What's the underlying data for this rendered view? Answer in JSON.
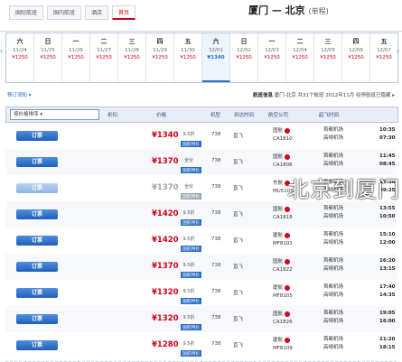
{
  "header": {
    "tabs": [
      "国际航班",
      "国内航班",
      "酒店",
      "首页"
    ],
    "route": "厦门 — 北京",
    "route_sub": "(单程)"
  },
  "date_strip": [
    {
      "dow": "六",
      "date": "11/24",
      "price": "¥1250"
    },
    {
      "dow": "日",
      "date": "11/25",
      "price": "¥1250"
    },
    {
      "dow": "一",
      "date": "11/26",
      "price": "¥1250"
    },
    {
      "dow": "二",
      "date": "11/27",
      "price": "¥1250"
    },
    {
      "dow": "三",
      "date": "11/28",
      "price": "¥1250"
    },
    {
      "dow": "四",
      "date": "11/29",
      "price": "¥1250"
    },
    {
      "dow": "五",
      "date": "11/30",
      "price": "¥1250"
    },
    {
      "dow": "六",
      "date": "12/01",
      "price": "¥1340"
    },
    {
      "dow": "日",
      "date": "12/02",
      "price": "¥1250"
    },
    {
      "dow": "一",
      "date": "12/03",
      "price": "¥1250"
    },
    {
      "dow": "二",
      "date": "12/04",
      "price": "¥1250"
    },
    {
      "dow": "三",
      "date": "12/05",
      "price": "¥1250"
    },
    {
      "dow": "四",
      "date": "12/06",
      "price": "¥1250"
    },
    {
      "dow": "五",
      "date": "12/07",
      "price": "¥1250"
    }
  ],
  "filters": {
    "left": "预订须知 ▾",
    "right_label": "航班信息",
    "right_text": "厦门-北京 共31个航班 2012年11月 经停航班已隐藏 ▸"
  },
  "table_headers": {
    "sort": "按价格排序 ▾",
    "col_price": "价格",
    "col_discount": "折扣",
    "col_type": "机型",
    "col_arrive": "到达时间",
    "col_airline": "航空公司",
    "col_depart": "起飞时间"
  },
  "flights": [
    {
      "book": "订票",
      "price": "¥1340",
      "disc": "9.5折",
      "tag": "国航特价",
      "type": "738",
      "stop": "直飞",
      "airline": "国航",
      "no": "CA1810",
      "arr_apt": "首都机场",
      "dep_apt": "高崎机场",
      "arr": "10:35",
      "dep": "07:30"
    },
    {
      "book": "订票",
      "price": "¥1370",
      "disc": "全价",
      "tag": "国航特价",
      "type": "738",
      "stop": "直飞",
      "airline": "国航",
      "no": "CA1806",
      "arr_apt": "首都机场",
      "dep_apt": "高崎机场",
      "arr": "11:45",
      "dep": "08:45"
    },
    {
      "book": "订票",
      "price": "¥1370",
      "disc": "全价",
      "tag": "国航特价",
      "type": "738",
      "stop": "直飞",
      "airline": "东航",
      "no": "MU5105",
      "arr_apt": "首都机场",
      "dep_apt": "高崎机场",
      "arr": "12:30",
      "dep": "09:25",
      "muted": true
    },
    {
      "book": "订票",
      "price": "¥1420",
      "disc": "9.5折",
      "tag": "国航特价",
      "type": "738",
      "stop": "直飞",
      "airline": "国航",
      "no": "CA1818",
      "arr_apt": "首都机场",
      "dep_apt": "高崎机场",
      "arr": "13:55",
      "dep": "10:50"
    },
    {
      "book": "订票",
      "price": "¥1420",
      "disc": "9.5折",
      "tag": "国航特价",
      "type": "738",
      "stop": "直飞",
      "airline": "厦航",
      "no": "MF8101",
      "arr_apt": "首都机场",
      "dep_apt": "高崎机场",
      "arr": "15:10",
      "dep": "12:00"
    },
    {
      "book": "订票",
      "price": "¥1370",
      "disc": "9.5折",
      "tag": "国航特价",
      "type": "738",
      "stop": "直飞",
      "airline": "国航",
      "no": "CA1822",
      "arr_apt": "首都机场",
      "dep_apt": "高崎机场",
      "arr": "16:20",
      "dep": "13:15"
    },
    {
      "book": "订票",
      "price": "¥1320",
      "disc": "9.5折",
      "tag": "国航特价",
      "type": "738",
      "stop": "直飞",
      "airline": "厦航",
      "no": "MF8105",
      "arr_apt": "首都机场",
      "dep_apt": "高崎机场",
      "arr": "17:40",
      "dep": "14:35"
    },
    {
      "book": "订票",
      "price": "¥1320",
      "disc": "9.5折",
      "tag": "国航特价",
      "type": "738",
      "stop": "直飞",
      "airline": "国航",
      "no": "CA1826",
      "arr_apt": "首都机场",
      "dep_apt": "高崎机场",
      "arr": "19:05",
      "dep": "16:00"
    },
    {
      "book": "订票",
      "price": "¥1280",
      "disc": "9.5折",
      "tag": "国航特价",
      "type": "738",
      "stop": "直飞",
      "airline": "厦航",
      "no": "MF8109",
      "arr_apt": "首都机场",
      "dep_apt": "高崎机场",
      "arr": "21:20",
      "dep": "18:15"
    }
  ],
  "watermark": "北京到厦门"
}
